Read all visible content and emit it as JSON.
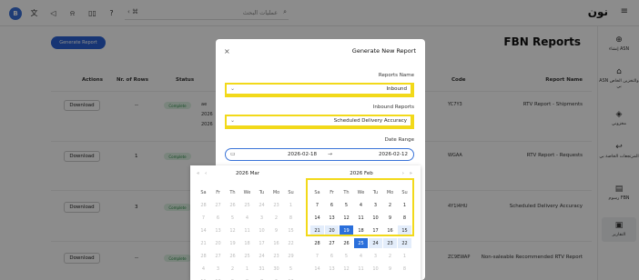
{
  "topbar": {
    "user_initial": "B",
    "icons": [
      "translate-icon",
      "megaphone-icon",
      "notification-icon",
      "book-icon",
      "help-icon"
    ],
    "search_placeholder": "عمليات البحث",
    "logo": "نون"
  },
  "sidebar": [
    {
      "icon": "plus-circle-icon",
      "label": "إنشاء ASN"
    },
    {
      "icon": "warehouse-icon",
      "label": "ASN والتخزين الخاص بي"
    },
    {
      "icon": "box-icon",
      "label": "مخزوني"
    },
    {
      "icon": "return-icon",
      "label": "المرتجعات الخاصة بي"
    },
    {
      "icon": "fees-icon",
      "label": "رسوم FBN"
    },
    {
      "icon": "report-icon",
      "label": "التقارير"
    }
  ],
  "main": {
    "generate_button": "Generate Report",
    "title": "FBN Reports",
    "columns": {
      "actions": "Actions",
      "rows": "Nr. of Rows",
      "status": "Status",
      "code": "Code",
      "report_name": "Report Name"
    },
    "download_label": "Download",
    "status_label": "Complete",
    "table_rows": [
      {
        "rows": "--",
        "code": "YC7Y3",
        "name": "RTV Report - Shipments",
        "extra": [
          "ae",
          "2026",
          "2026"
        ]
      },
      {
        "rows": "1",
        "code": "WGAA",
        "name": "RTV Report - Requests",
        "extra": []
      },
      {
        "rows": "3",
        "code": "4Y1I4HU",
        "name": "Scheduled Delivery Accuracy",
        "extra": []
      },
      {
        "rows": "--",
        "code": "ZC9EWAP",
        "name": "Non-saleable Recommended RTV Report",
        "extra": []
      }
    ]
  },
  "modal": {
    "title": "Generate New Report",
    "report_name_label": "Reports Name",
    "report_name_value": "Inbound",
    "inbound_reports_label": "Inbound Reports",
    "inbound_reports_value": "Scheduled Delivery Accuracy",
    "date_range_label": "Date Range",
    "date_start": "2026-02-18",
    "date_end": "2026-02-12",
    "date_sep": "→"
  },
  "calendar": {
    "days_of_week": [
      "Sa",
      "Fr",
      "Th",
      "We",
      "Tu",
      "Mo",
      "Su"
    ],
    "left_header": "2026  Mar",
    "right_header": "2026  Feb",
    "left_cells": [
      [
        "28",
        "27",
        "26",
        "25",
        "24",
        "23",
        "1"
      ],
      [
        "7",
        "6",
        "5",
        "4",
        "3",
        "2",
        "8"
      ],
      [
        "14",
        "13",
        "12",
        "11",
        "10",
        "9",
        "15"
      ],
      [
        "21",
        "20",
        "19",
        "18",
        "17",
        "16",
        "22"
      ],
      [
        "28",
        "27",
        "26",
        "25",
        "24",
        "23",
        "29"
      ],
      [
        "4",
        "3",
        "2",
        "1",
        "31",
        "30",
        "5"
      ],
      [
        "11",
        "10",
        "9",
        "8",
        "7",
        "6",
        "12"
      ]
    ],
    "right_cells": [
      [
        "7",
        "6",
        "5",
        "4",
        "3",
        "2",
        "1"
      ],
      [
        "14",
        "13",
        "12",
        "11",
        "10",
        "9",
        "8"
      ],
      [
        "21",
        "20",
        "19",
        "18",
        "17",
        "16",
        "15"
      ],
      [
        "28",
        "27",
        "26",
        "25",
        "24",
        "23",
        "22"
      ],
      [
        "7",
        "6",
        "5",
        "4",
        "3",
        "2",
        "1"
      ],
      [
        "14",
        "13",
        "12",
        "11",
        "10",
        "9",
        "8"
      ]
    ],
    "colors": {
      "selected": "#2a6fdb",
      "range": "#e3edfb",
      "highlight_box": "#f2d91a"
    }
  }
}
